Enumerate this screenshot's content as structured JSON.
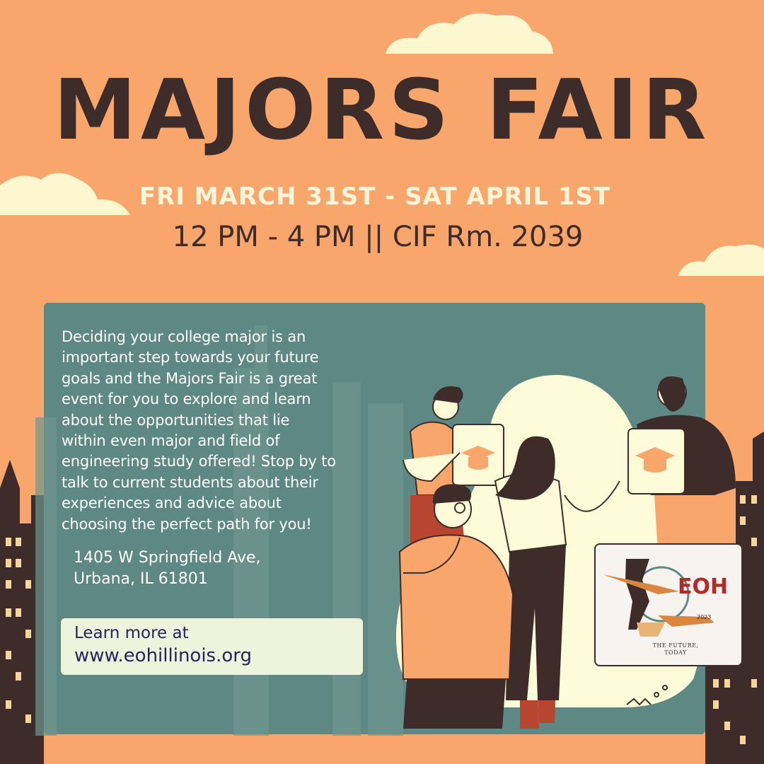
{
  "poster": {
    "title": "MAJORS FAIR",
    "dates": "FRI MARCH 31ST - SAT APRIL 1ST",
    "time_location": "12 PM - 4 PM || CIF Rm. 2039"
  },
  "info": {
    "description_lines": [
      "Deciding your college major is an",
      "important step towards your future",
      "goals and the Majors Fair is a great",
      "event for you to explore and learn",
      "about the opportunities that lie",
      "within even major and field of",
      "engineering study offered! Stop by to",
      "talk to current students about their",
      "experiences and advice about",
      "choosing the perfect path for you!"
    ],
    "address_line1": "1405 W Springfield Ave,",
    "address_line2": "Urbana, IL 61801"
  },
  "cta": {
    "line1": "Learn more at",
    "url": "www.eohillinois.org"
  },
  "logo": {
    "name": "EOH",
    "year": "2023",
    "tagline_line1": "THE FUTURE,",
    "tagline_line2": "TODAY"
  },
  "colors": {
    "background": "#F9A66C",
    "title": "#3E2C2A",
    "dates": "#FDF5D8",
    "panel": "#5E8884",
    "cta_bg": "#EEF3DC",
    "cta_text": "#2A1F5C"
  }
}
